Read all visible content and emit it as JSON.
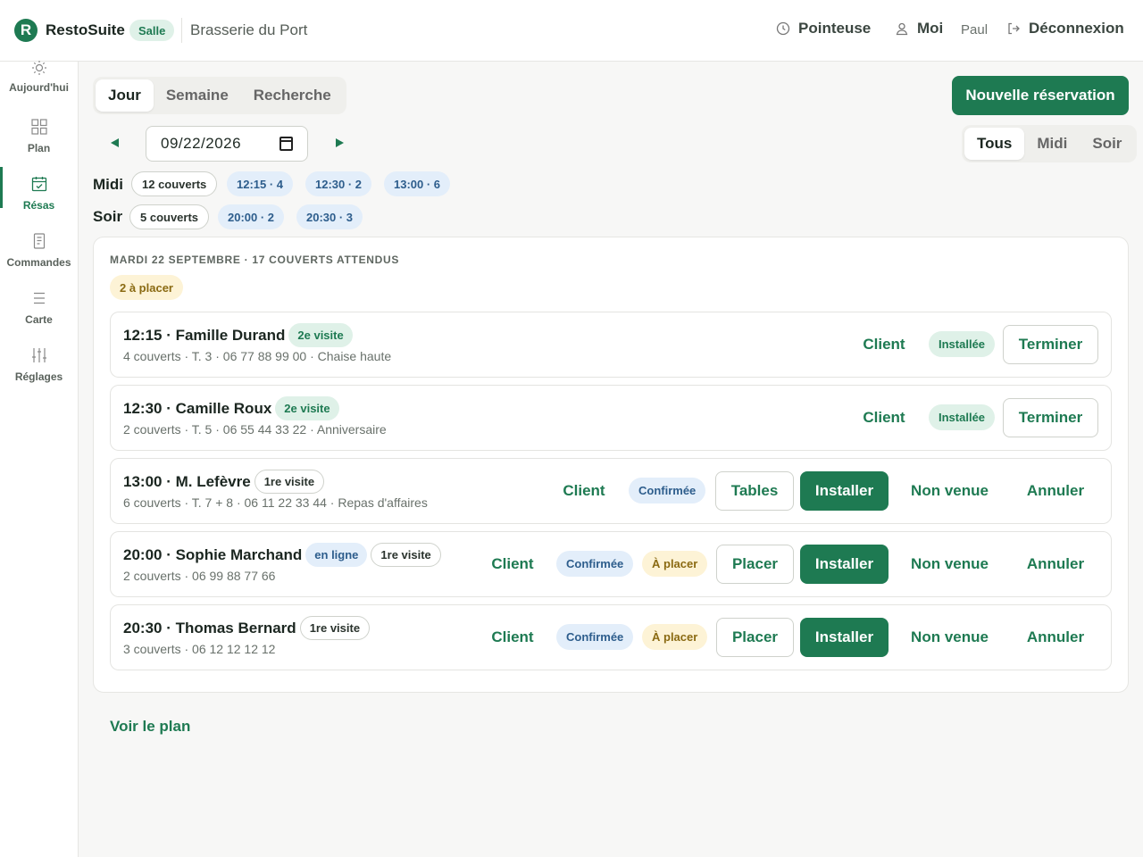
{
  "header": {
    "logo_letter": "R",
    "app_name": "RestoSuite",
    "mode_badge": "Salle",
    "restaurant": "Brasserie du Port",
    "pointeuse": "Pointeuse",
    "me": "Moi",
    "user": "Paul",
    "logout": "Déconnexion"
  },
  "sidebar": {
    "items": [
      {
        "label": "Aujourd'hui",
        "icon": "sun-icon"
      },
      {
        "label": "Plan",
        "icon": "grid-icon"
      },
      {
        "label": "Résas",
        "icon": "calendar-icon"
      },
      {
        "label": "Commandes",
        "icon": "receipt-icon"
      },
      {
        "label": "Carte",
        "icon": "menu-icon"
      },
      {
        "label": "Réglages",
        "icon": "sliders-icon"
      }
    ]
  },
  "view_tabs": [
    "Jour",
    "Semaine",
    "Recherche"
  ],
  "new_reservation": "Nouvelle réservation",
  "date_value": "09/22/2026",
  "service_filter": [
    "Tous",
    "Midi",
    "Soir"
  ],
  "services": {
    "midi": {
      "label": "Midi",
      "total": "12 couverts",
      "slots": [
        "12:15 · 4",
        "12:30 · 2",
        "13:00 · 6"
      ]
    },
    "soir": {
      "label": "Soir",
      "total": "5 couverts",
      "slots": [
        "20:00 · 2",
        "20:30 · 3"
      ]
    }
  },
  "card": {
    "heading": "MARDI 22 SEPTEMBRE · 17 COUVERTS ATTENDUS",
    "to_place": "2 à placer"
  },
  "reservations": [
    {
      "title": "12:15 · Famille Durand",
      "visit": "2e visite",
      "meta": "4 couverts · T. 3 · 06 77 88 99 00 · Chaise haute",
      "client": "Client",
      "status": "Installée",
      "action": "Terminer"
    },
    {
      "title": "12:30 · Camille Roux",
      "visit": "2e visite",
      "meta": "2 couverts · T. 5 · 06 55 44 33 22 · Anniversaire",
      "client": "Client",
      "status": "Installée",
      "action": "Terminer"
    },
    {
      "title": "13:00 · M. Lefèvre",
      "visit": "1re visite",
      "meta": "6 couverts · T. 7 + 8 · 06 11 22 33 44 · Repas d'affaires",
      "client": "Client",
      "status": "Confirmée",
      "tables": "Tables",
      "install": "Installer",
      "noshow": "Non venue",
      "cancel": "Annuler"
    },
    {
      "title": "20:00 · Sophie Marchand",
      "source": "en ligne",
      "visit": "1re visite",
      "meta": "2 couverts · 06 99 88 77 66",
      "client": "Client",
      "status": "Confirmée",
      "to_place": "À placer",
      "place": "Placer",
      "install": "Installer",
      "noshow": "Non venue",
      "cancel": "Annuler"
    },
    {
      "title": "20:30 · Thomas Bernard",
      "visit": "1re visite",
      "meta": "3 couverts · 06 12 12 12 12",
      "client": "Client",
      "status": "Confirmée",
      "to_place": "À placer",
      "place": "Placer",
      "install": "Installer",
      "noshow": "Non venue",
      "cancel": "Annuler"
    }
  ],
  "see_plan": "Voir le plan",
  "colors": {
    "brand": "#1e7a52",
    "info": "#2d5d8c",
    "warning": "#8a6a12"
  }
}
